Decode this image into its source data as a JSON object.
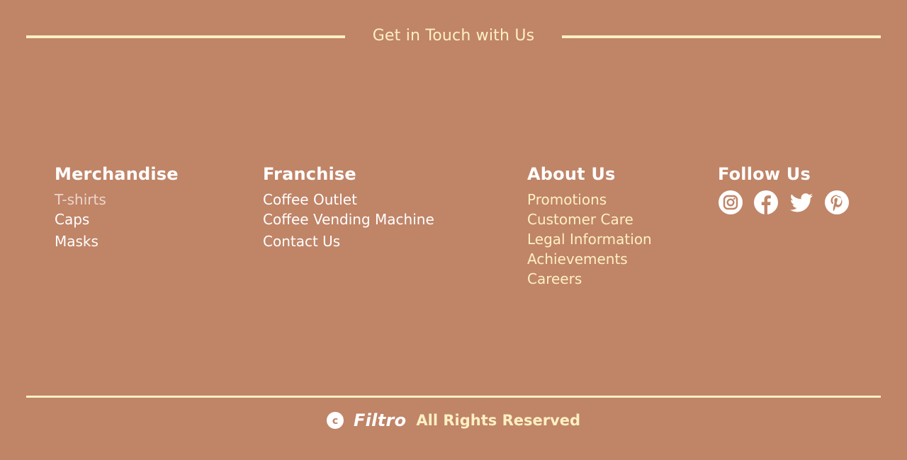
{
  "touch": {
    "title": "Get in Touch with Us"
  },
  "columns": {
    "merchandise": {
      "heading": "Merchandise",
      "items": [
        "T-shirts",
        "Caps",
        "Masks"
      ]
    },
    "franchise": {
      "heading": "Franchise",
      "items": [
        "Coffee Outlet",
        "Coffee Vending Machine",
        "Contact Us"
      ]
    },
    "about": {
      "heading": "About Us",
      "items": [
        "Promotions",
        "Customer Care",
        "Legal Information",
        "Achievements",
        "Careers"
      ]
    },
    "follow": {
      "heading": "Follow Us",
      "icons": [
        "instagram-icon",
        "facebook-icon",
        "twitter-icon",
        "pinterest-icon"
      ]
    }
  },
  "footer": {
    "brand": "Filtro",
    "rights": "All Rights Reserved",
    "icon": "copyright-icon"
  },
  "colors": {
    "background": "#c08467",
    "accent": "#fdf0c4",
    "heading": "#ffffff"
  }
}
